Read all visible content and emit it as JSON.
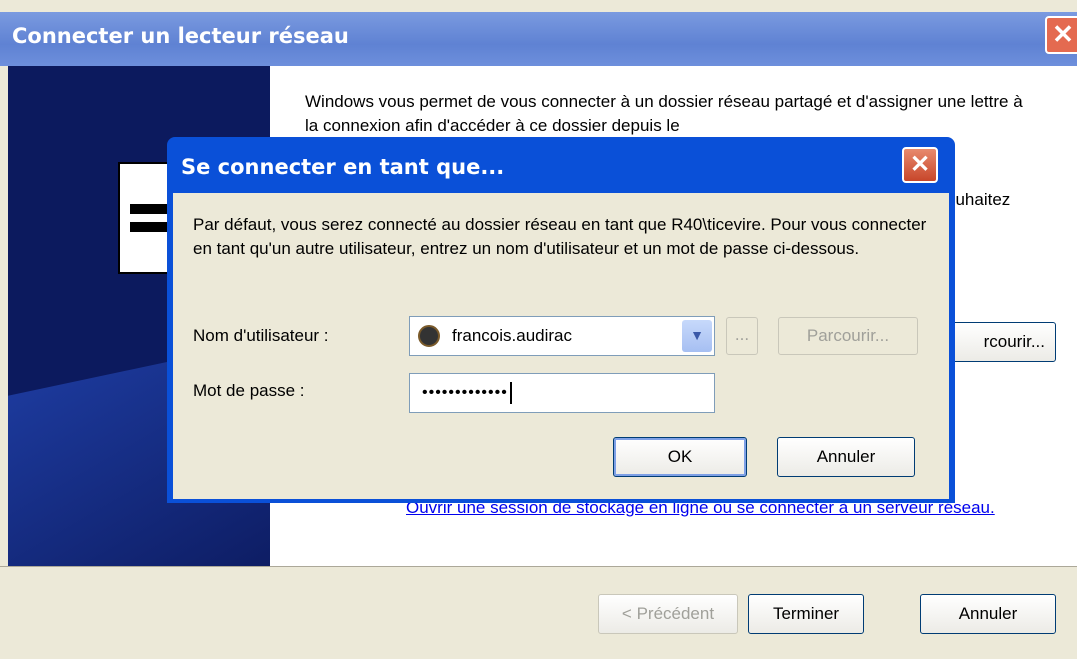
{
  "window": {
    "title": "Connecter un lecteur réseau",
    "intro_text": "Windows vous permet de vous connecter à un dossier réseau partagé et d'assigner une lettre à la connexion afin d'accéder à ce dossier depuis le",
    "fragment_text": "ouhaitez",
    "browse_fragment": "rcourir...",
    "link_text": "Ouvrir une session de stockage en ligne ou se connecter à un serveur réseau."
  },
  "footer": {
    "prev_label": "< Précédent",
    "finish_label": "Terminer",
    "cancel_label": "Annuler"
  },
  "dialog": {
    "title": "Se connecter en tant que...",
    "message": "Par défaut, vous serez connecté au dossier réseau en tant que R40\\ticevire. Pour vous connecter en tant qu'un autre utilisateur, entrez un nom d'utilisateur et un mot de passe ci-dessous.",
    "username_label": "Nom d'utilisateur :",
    "username_value": "francois.audirac",
    "password_label": "Mot de passe :",
    "password_value": "•••••••••••••",
    "ellipsis_label": "...",
    "browse_label": "Parcourir...",
    "ok_label": "OK",
    "cancel_label": "Annuler"
  }
}
